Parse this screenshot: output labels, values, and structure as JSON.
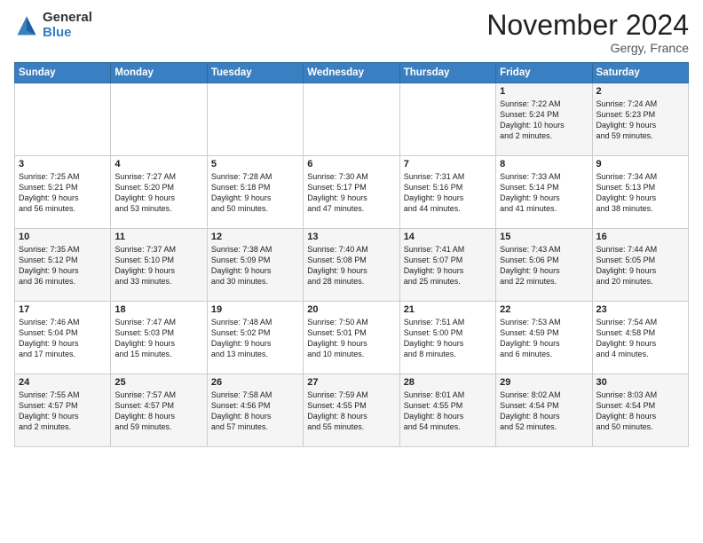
{
  "header": {
    "logo_general": "General",
    "logo_blue": "Blue",
    "month_title": "November 2024",
    "location": "Gergy, France"
  },
  "weekdays": [
    "Sunday",
    "Monday",
    "Tuesday",
    "Wednesday",
    "Thursday",
    "Friday",
    "Saturday"
  ],
  "weeks": [
    [
      {
        "day": "",
        "info": ""
      },
      {
        "day": "",
        "info": ""
      },
      {
        "day": "",
        "info": ""
      },
      {
        "day": "",
        "info": ""
      },
      {
        "day": "",
        "info": ""
      },
      {
        "day": "1",
        "info": "Sunrise: 7:22 AM\nSunset: 5:24 PM\nDaylight: 10 hours\nand 2 minutes."
      },
      {
        "day": "2",
        "info": "Sunrise: 7:24 AM\nSunset: 5:23 PM\nDaylight: 9 hours\nand 59 minutes."
      }
    ],
    [
      {
        "day": "3",
        "info": "Sunrise: 7:25 AM\nSunset: 5:21 PM\nDaylight: 9 hours\nand 56 minutes."
      },
      {
        "day": "4",
        "info": "Sunrise: 7:27 AM\nSunset: 5:20 PM\nDaylight: 9 hours\nand 53 minutes."
      },
      {
        "day": "5",
        "info": "Sunrise: 7:28 AM\nSunset: 5:18 PM\nDaylight: 9 hours\nand 50 minutes."
      },
      {
        "day": "6",
        "info": "Sunrise: 7:30 AM\nSunset: 5:17 PM\nDaylight: 9 hours\nand 47 minutes."
      },
      {
        "day": "7",
        "info": "Sunrise: 7:31 AM\nSunset: 5:16 PM\nDaylight: 9 hours\nand 44 minutes."
      },
      {
        "day": "8",
        "info": "Sunrise: 7:33 AM\nSunset: 5:14 PM\nDaylight: 9 hours\nand 41 minutes."
      },
      {
        "day": "9",
        "info": "Sunrise: 7:34 AM\nSunset: 5:13 PM\nDaylight: 9 hours\nand 38 minutes."
      }
    ],
    [
      {
        "day": "10",
        "info": "Sunrise: 7:35 AM\nSunset: 5:12 PM\nDaylight: 9 hours\nand 36 minutes."
      },
      {
        "day": "11",
        "info": "Sunrise: 7:37 AM\nSunset: 5:10 PM\nDaylight: 9 hours\nand 33 minutes."
      },
      {
        "day": "12",
        "info": "Sunrise: 7:38 AM\nSunset: 5:09 PM\nDaylight: 9 hours\nand 30 minutes."
      },
      {
        "day": "13",
        "info": "Sunrise: 7:40 AM\nSunset: 5:08 PM\nDaylight: 9 hours\nand 28 minutes."
      },
      {
        "day": "14",
        "info": "Sunrise: 7:41 AM\nSunset: 5:07 PM\nDaylight: 9 hours\nand 25 minutes."
      },
      {
        "day": "15",
        "info": "Sunrise: 7:43 AM\nSunset: 5:06 PM\nDaylight: 9 hours\nand 22 minutes."
      },
      {
        "day": "16",
        "info": "Sunrise: 7:44 AM\nSunset: 5:05 PM\nDaylight: 9 hours\nand 20 minutes."
      }
    ],
    [
      {
        "day": "17",
        "info": "Sunrise: 7:46 AM\nSunset: 5:04 PM\nDaylight: 9 hours\nand 17 minutes."
      },
      {
        "day": "18",
        "info": "Sunrise: 7:47 AM\nSunset: 5:03 PM\nDaylight: 9 hours\nand 15 minutes."
      },
      {
        "day": "19",
        "info": "Sunrise: 7:48 AM\nSunset: 5:02 PM\nDaylight: 9 hours\nand 13 minutes."
      },
      {
        "day": "20",
        "info": "Sunrise: 7:50 AM\nSunset: 5:01 PM\nDaylight: 9 hours\nand 10 minutes."
      },
      {
        "day": "21",
        "info": "Sunrise: 7:51 AM\nSunset: 5:00 PM\nDaylight: 9 hours\nand 8 minutes."
      },
      {
        "day": "22",
        "info": "Sunrise: 7:53 AM\nSunset: 4:59 PM\nDaylight: 9 hours\nand 6 minutes."
      },
      {
        "day": "23",
        "info": "Sunrise: 7:54 AM\nSunset: 4:58 PM\nDaylight: 9 hours\nand 4 minutes."
      }
    ],
    [
      {
        "day": "24",
        "info": "Sunrise: 7:55 AM\nSunset: 4:57 PM\nDaylight: 9 hours\nand 2 minutes."
      },
      {
        "day": "25",
        "info": "Sunrise: 7:57 AM\nSunset: 4:57 PM\nDaylight: 8 hours\nand 59 minutes."
      },
      {
        "day": "26",
        "info": "Sunrise: 7:58 AM\nSunset: 4:56 PM\nDaylight: 8 hours\nand 57 minutes."
      },
      {
        "day": "27",
        "info": "Sunrise: 7:59 AM\nSunset: 4:55 PM\nDaylight: 8 hours\nand 55 minutes."
      },
      {
        "day": "28",
        "info": "Sunrise: 8:01 AM\nSunset: 4:55 PM\nDaylight: 8 hours\nand 54 minutes."
      },
      {
        "day": "29",
        "info": "Sunrise: 8:02 AM\nSunset: 4:54 PM\nDaylight: 8 hours\nand 52 minutes."
      },
      {
        "day": "30",
        "info": "Sunrise: 8:03 AM\nSunset: 4:54 PM\nDaylight: 8 hours\nand 50 minutes."
      }
    ]
  ]
}
